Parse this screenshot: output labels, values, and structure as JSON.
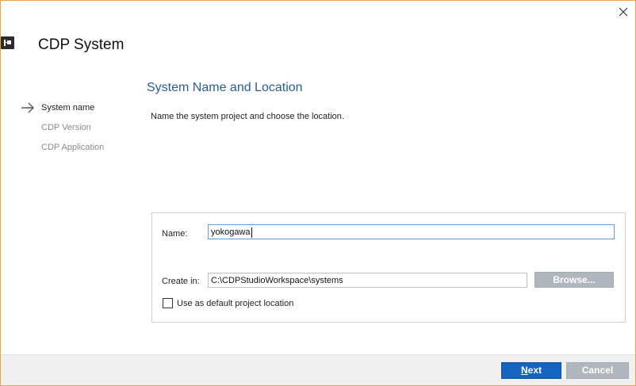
{
  "window": {
    "title": "CDP System",
    "close_icon": "close-icon",
    "app_icon": "cdp-app-icon"
  },
  "steps": {
    "items": [
      {
        "label": "System name",
        "active": true
      },
      {
        "label": "CDP Version",
        "active": false
      },
      {
        "label": "CDP Application",
        "active": false
      }
    ],
    "current_icon": "arrow-right-icon"
  },
  "page": {
    "title": "System Name and Location",
    "description": "Name the system project and choose the location."
  },
  "form": {
    "name_label": "Name:",
    "name_value": "yokogawa",
    "create_in_label": "Create in:",
    "create_in_value": "C:\\CDPStudioWorkspace\\systems",
    "browse_label": "Browse...",
    "default_location_label": "Use as default project location",
    "default_location_checked": false
  },
  "footer": {
    "next_mnemonic": "N",
    "next_rest": "ext",
    "cancel_label": "Cancel"
  },
  "colors": {
    "accent": "#1565c0",
    "section_title": "#2a5d96",
    "window_border": "#e8a34a",
    "disabled_button": "#b0b6bd"
  }
}
